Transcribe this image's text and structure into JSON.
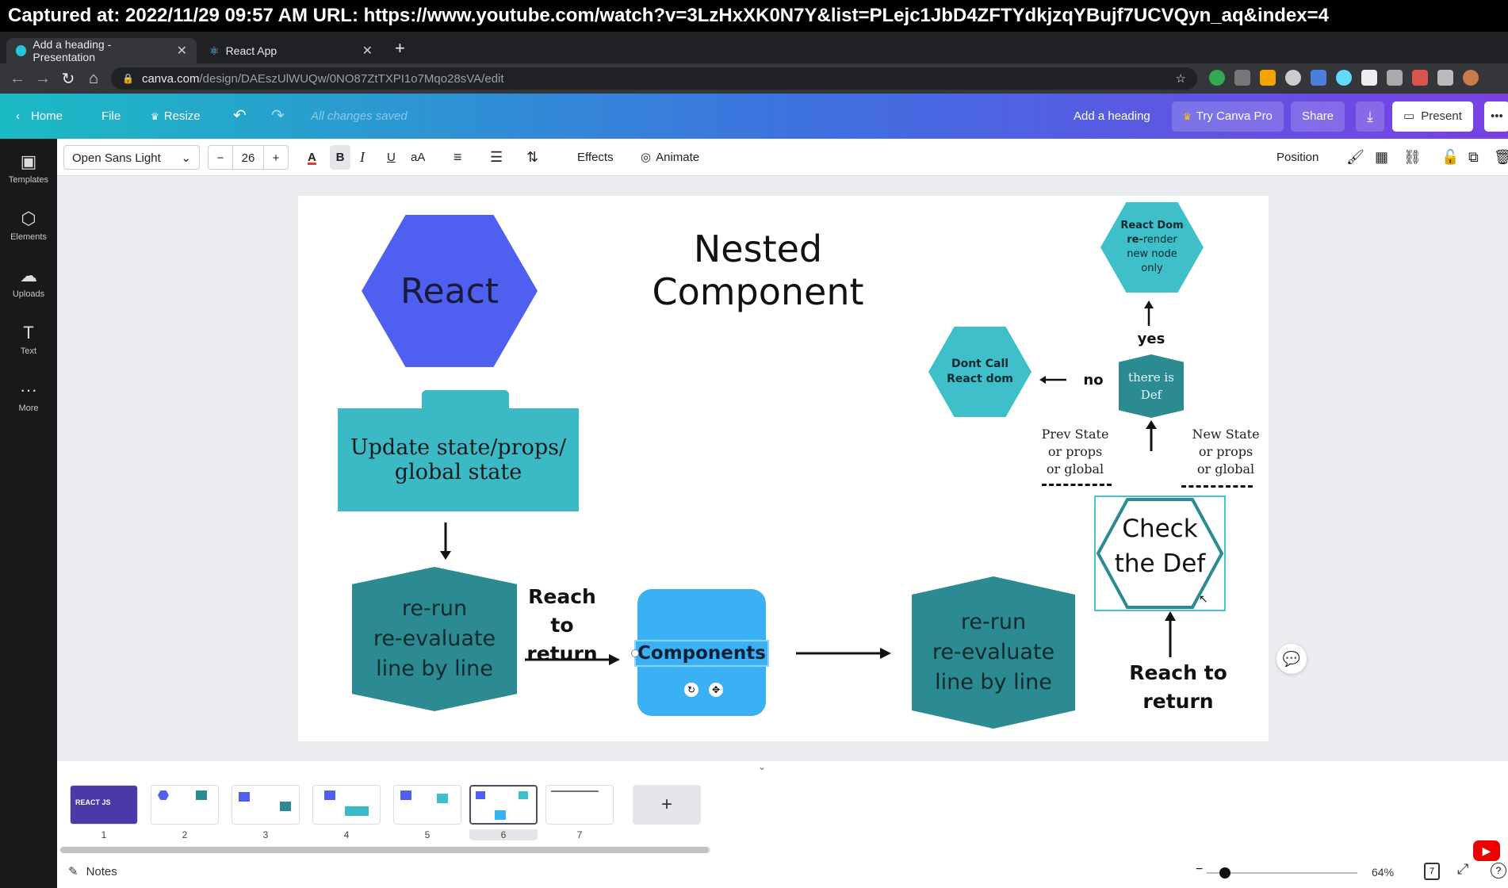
{
  "capture": {
    "text": "Captured at: 2022/11/29 09:57 AM    URL: https://www.youtube.com/watch?v=3LzHxXK0N7Y&list=PLejc1JbD4ZFTYdkjzqYBujf7UCVQyn_aq&index=4"
  },
  "browser": {
    "tabs": [
      {
        "label": "Add a heading - Presentation",
        "close": "✕"
      },
      {
        "label": "React App",
        "close": "✕"
      }
    ],
    "new_tab": "+",
    "url_host": "canva.com",
    "url_path": "/design/DAEszUlWUQw/0NO87ZtTXPI1o7Mqo28sVA/edit"
  },
  "canva_header": {
    "home": "Home",
    "file": "File",
    "resize": "Resize",
    "status": "All changes saved",
    "doc_title": "Add a heading",
    "try_pro": "Try Canva Pro",
    "share": "Share",
    "present": "Present",
    "more": "•••"
  },
  "rail": [
    {
      "label": "Templates",
      "icon": "▣"
    },
    {
      "label": "Elements",
      "icon": "⬡"
    },
    {
      "label": "Uploads",
      "icon": "☁"
    },
    {
      "label": "Text",
      "icon": "T"
    },
    {
      "label": "More",
      "icon": "···"
    }
  ],
  "toolbar": {
    "font": "Open Sans Light",
    "minus": "−",
    "size": "26",
    "plus": "+",
    "bold": "B",
    "italic": "I",
    "underline": "U",
    "case": "aA",
    "effects": "Effects",
    "animate": "Animate",
    "position": "Position"
  },
  "slide": {
    "title": "Nested Component",
    "react": "React",
    "update_line1": "Update state/props/",
    "update_line2": "global  state",
    "rerun_left": [
      "re-run",
      "re-evaluate",
      "line by line"
    ],
    "reach_left": [
      "Reach to",
      "return"
    ],
    "components": "Components",
    "rerun_right": [
      "re-run",
      "re-evaluate",
      "line by line"
    ],
    "check_def": [
      "Check",
      "the Def"
    ],
    "reach_right": [
      "Reach to",
      "return"
    ],
    "prev_state": [
      "Prev State",
      "or props",
      "or global"
    ],
    "new_state": [
      "New State",
      "or props",
      "or global"
    ],
    "there_is_def": [
      "there is",
      "Def"
    ],
    "no": "no",
    "yes": "yes",
    "dont_call": [
      "Dont Call",
      "React dom"
    ],
    "react_dom_bold1": "React Dom",
    "react_dom_bold2": "re-",
    "react_dom_rest": [
      "render",
      "new node",
      "only"
    ]
  },
  "pages": {
    "items": [
      "1",
      "2",
      "3",
      "4",
      "5",
      "6",
      "7"
    ],
    "add": "+",
    "selected": 6,
    "thumb1_text": "REACT JS"
  },
  "footer": {
    "notes": "Notes",
    "zoom": "64%",
    "page_count": "7"
  },
  "colors": {
    "react_hex": "#4f5ff0",
    "teal_light": "#3bbac6",
    "teal_dark": "#2b8a92",
    "components_blue": "#3ab0f5",
    "hex_teal": "#3fbfca"
  }
}
